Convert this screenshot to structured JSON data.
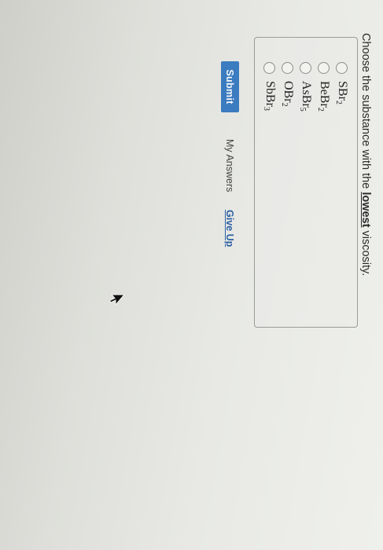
{
  "question": {
    "prefix": "Choose the substance with the ",
    "emphasis": "lowest",
    "suffix": " viscosity."
  },
  "options": [
    {
      "base": "SBr",
      "sub": "2"
    },
    {
      "base": "BeBr",
      "sub": "2"
    },
    {
      "base": "AsBr",
      "sub": "5"
    },
    {
      "base": "OBr",
      "sub": "2"
    },
    {
      "base": "SbBr",
      "sub": "3"
    }
  ],
  "actions": {
    "submit_label": "Submit",
    "my_answers_label": "My Answers",
    "give_up_label": "Give Up"
  },
  "colors": {
    "submit_bg": "#3b7bbf",
    "link": "#2b5fa3"
  },
  "icons": {
    "cursor": "mouse-pointer-icon"
  }
}
